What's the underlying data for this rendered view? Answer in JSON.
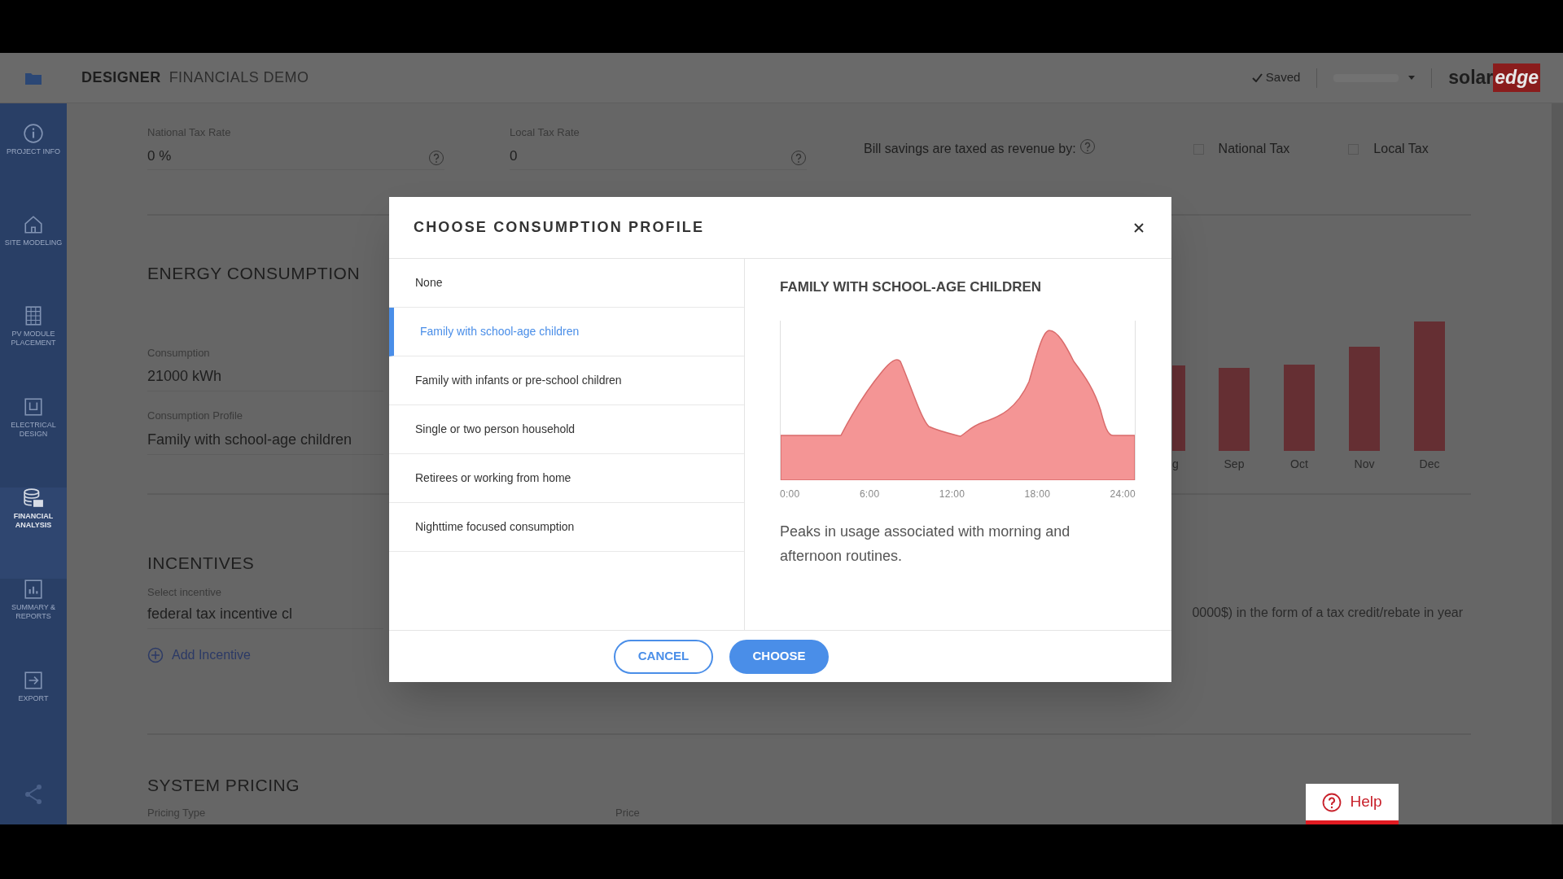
{
  "header": {
    "title": "DESIGNER",
    "subtitle": "FINANCIALS DEMO",
    "save_status": "Saved",
    "logo": {
      "part_1": "solar",
      "part_2": "edge"
    }
  },
  "sidebar": {
    "items": [
      {
        "label": "PROJECT INFO",
        "kind": "info",
        "selected": false
      },
      {
        "label": "SITE MODELING",
        "kind": "home",
        "selected": false
      },
      {
        "label": "PV MODULE PLACEMENT",
        "kind": "grid",
        "selected": false
      },
      {
        "label": "ELECTRICAL DESIGN",
        "kind": "chip",
        "selected": false
      },
      {
        "label": "FINANCIAL ANALYSIS",
        "kind": "coins",
        "selected": true
      },
      {
        "label": "SUMMARY & REPORTS",
        "kind": "report",
        "selected": false
      },
      {
        "label": "EXPORT",
        "kind": "export",
        "selected": false
      }
    ]
  },
  "tax": {
    "fields": [
      {
        "label": "National Tax Rate",
        "value": "0 %"
      },
      {
        "label": "Local Tax Rate",
        "value": "0"
      }
    ],
    "bill_savings_label": "Bill savings are taxed as revenue by:",
    "options": [
      {
        "label": "National Tax",
        "checked": false
      },
      {
        "label": "Local Tax",
        "checked": false
      }
    ]
  },
  "energy_consumption": {
    "title": "ENERGY CONSUMPTION",
    "fields": [
      {
        "label": "Consumption",
        "value": "21000 kWh"
      },
      {
        "label": "Consumption Profile",
        "value": "Family with school-age children"
      }
    ],
    "chart_months": [
      "g",
      "Sep",
      "Oct",
      "Nov",
      "Dec"
    ]
  },
  "incentives": {
    "title": "INCENTIVES",
    "field": {
      "label": "Select incentive",
      "value": "federal tax incentive cl"
    },
    "add_link": "Add Incentive",
    "description": "0000$) in the form of a tax credit/rebate in year"
  },
  "system_pricing": {
    "title": "SYSTEM PRICING",
    "labels": [
      "Pricing Type",
      "Price"
    ]
  },
  "help_button": "Help",
  "dialog": {
    "title": "CHOOSE CONSUMPTION PROFILE",
    "profiles": [
      {
        "label": "None",
        "selected": false
      },
      {
        "label": "Family with school-age children",
        "selected": true
      },
      {
        "label": "Family with infants or pre-school children",
        "selected": false
      },
      {
        "label": "Single or two person household",
        "selected": false
      },
      {
        "label": "Retirees or working from home",
        "selected": false
      },
      {
        "label": "Nighttime focused consumption",
        "selected": false
      }
    ],
    "preview": {
      "title": "FAMILY WITH SCHOOL-AGE CHILDREN",
      "x_tick_labels": [
        "0:00",
        "6:00",
        "12:00",
        "18:00",
        "24:00"
      ],
      "description": "Peaks in usage associated with morning and afternoon routines."
    },
    "buttons": [
      {
        "label": "CANCEL",
        "kind": "secondary"
      },
      {
        "label": "CHOOSE",
        "kind": "primary"
      }
    ]
  }
}
